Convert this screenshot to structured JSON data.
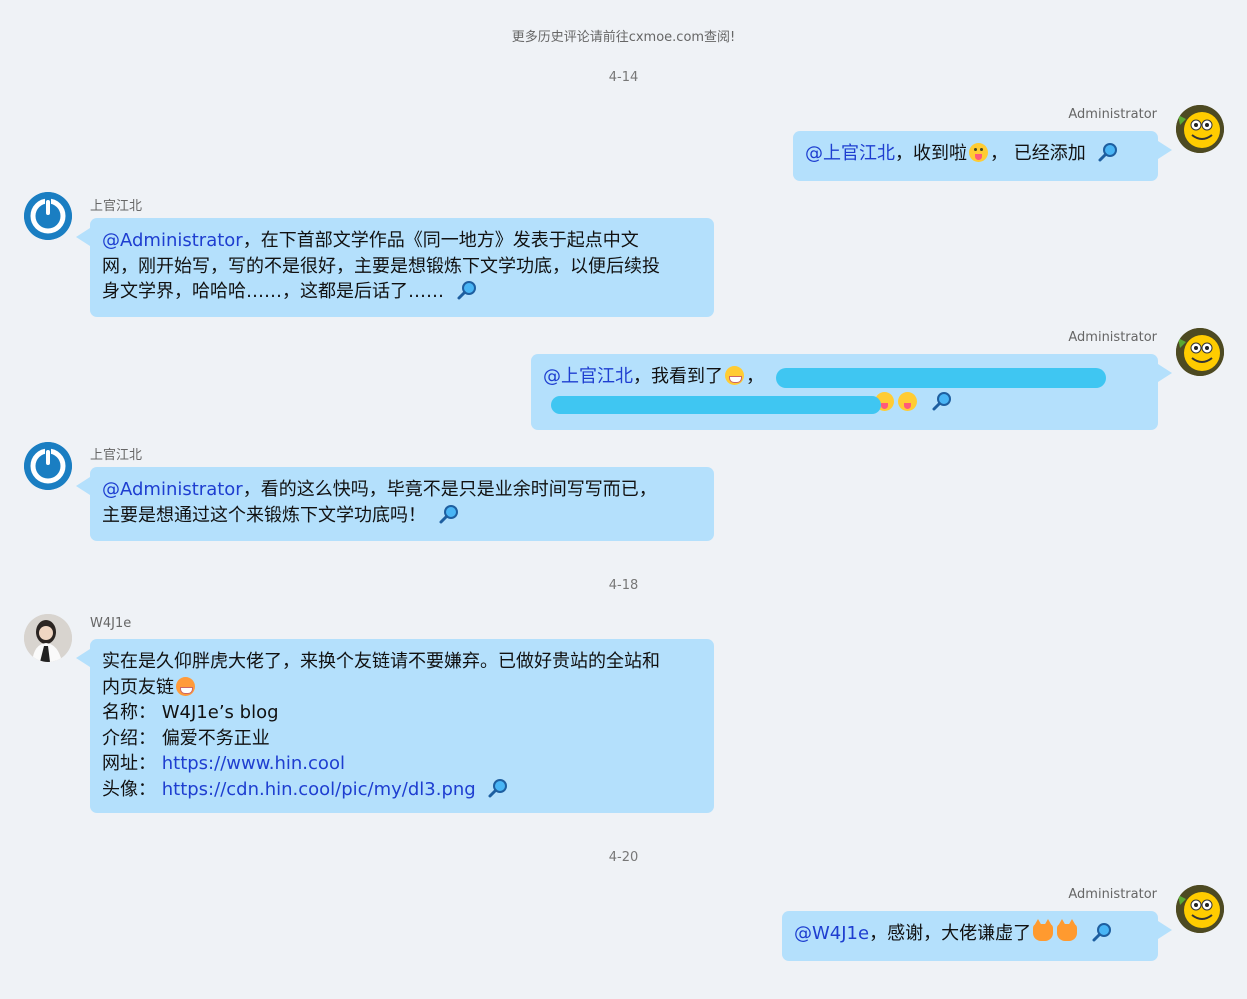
{
  "notice": "更多历史评论请前往cxmoe.com查阅!",
  "dates": [
    "4-14",
    "4-18",
    "4-20"
  ],
  "messages": [
    {
      "author": "Administrator",
      "mention": "@上官江北",
      "text_a": "，收到啦",
      "text_b": "， 已经添加"
    },
    {
      "author": "上官江北",
      "mention": "@Administrator",
      "line1": "，在下首部文学作品《同一地方》发表于起点中文",
      "line2": "网，刚开始写，写的不是很好，主要是想锻炼下文学功底，以便后续投",
      "line3": "身文学界，哈哈哈……，这都是后话了……"
    },
    {
      "author": "Administrator",
      "mention": "@上官江北",
      "text_a": "，我看到了",
      "text_b": "，"
    },
    {
      "author": "上官江北",
      "mention": "@Administrator",
      "line1": "，看的这么快吗，毕竟不是只是业余时间写写而已，",
      "line2": "主要是想通过这个来锻炼下文学功底吗！"
    },
    {
      "author": "W4J1e",
      "line1": "实在是久仰胖虎大佬了，来换个友链请不要嫌弃。已做好贵站的全站和",
      "line2": "内页友链",
      "fields": [
        {
          "label": "名称：",
          "value": "W4J1e’s blog"
        },
        {
          "label": "介绍：",
          "value": "偏爱不务正业"
        },
        {
          "label": "网址：",
          "value": "https://www.hin.cool"
        },
        {
          "label": "头像：",
          "value": "https://cdn.hin.cool/pic/my/dl3.png"
        }
      ]
    },
    {
      "author": "Administrator",
      "mention": "@W4J1e",
      "text": "，感谢，大佬谦虚了"
    }
  ],
  "icons": {
    "reply": "search-icon",
    "emoji": "emoji-icon"
  },
  "colors": {
    "background": "#eff2f6",
    "bubble": "#b4e0fc",
    "mention": "#1e3ed0",
    "redaction": "#3fc6f2"
  }
}
